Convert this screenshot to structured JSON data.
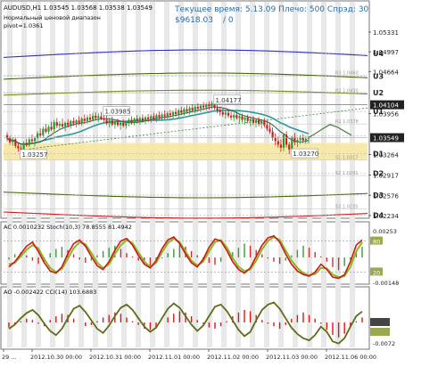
{
  "header": {
    "symbol_line": "AUDUSD,H1  1.03545 1.03568 1.03538 1.03549",
    "indicator_name": "Нормальный ценовой диапазон",
    "pivot_label": "pivot=1.0361",
    "status_line": "Текущее время: 5.13.09 Плечо: 500 Спрэд: 30",
    "balance": "$9618.03",
    "balance_suffix": "/ 0"
  },
  "colors": {
    "candle_up": "#2a9a2a",
    "candle_down": "#cc2020",
    "price_line": "#c04040",
    "ma_teal": "#2a9a98",
    "ma_dark": "#2c5a50",
    "band_green": "#7a8f1a",
    "band_dark_green": "#4a6a10",
    "band_blue": "#3030c0",
    "band_red": "#cc2020",
    "range_fill": "#f5e7a0",
    "stoch_main": "#d01818",
    "stoch_signal": "#8ab820",
    "cci_line": "#5a7018",
    "ao_bar": "#d81818"
  },
  "price_axis": {
    "labels": [
      {
        "text": "1.05331",
        "value": 1.05331
      },
      {
        "text": "1.04997",
        "value": 1.04997
      },
      {
        "text": "1.04664",
        "value": 1.04664
      },
      {
        "text": "1.04104",
        "value": 1.04104,
        "highlight": true
      },
      {
        "text": "1.03956",
        "value": 1.03956
      },
      {
        "text": "1.03549",
        "value": 1.03549,
        "highlight": true
      },
      {
        "text": "1.03264",
        "value": 1.03264
      },
      {
        "text": "1.02917",
        "value": 1.02917
      },
      {
        "text": "1.02576",
        "value": 1.02576
      },
      {
        "text": "1.02234",
        "value": 1.02234
      }
    ]
  },
  "pivot_levels": [
    {
      "label": "U4",
      "value": 1.0497
    },
    {
      "label": "U3",
      "value": 1.0459
    },
    {
      "label": "U2",
      "value": 1.0431
    },
    {
      "label": "U1",
      "value": 1.0399
    },
    {
      "label": "LB",
      "value": 1.0358
    },
    {
      "label": "D1",
      "value": 1.0328
    },
    {
      "label": "D2",
      "value": 1.0295
    },
    {
      "label": "D3",
      "value": 1.0258
    },
    {
      "label": "D4",
      "value": 1.0224
    }
  ],
  "faint_levels": [
    {
      "label": "R3 1.0460",
      "value": 1.046
    },
    {
      "label": "R2 1.0430",
      "value": 1.043
    },
    {
      "label": "R1 1.0378",
      "value": 1.0378
    },
    {
      "label": "S1 1.0317",
      "value": 1.0317
    },
    {
      "label": "S2 1.0291",
      "value": 1.0291
    },
    {
      "label": "S3 1.0235",
      "value": 1.0235
    }
  ],
  "price_annotations": [
    {
      "text": "1.03985",
      "value": 1.03985,
      "bar": 35
    },
    {
      "text": "1.04177",
      "value": 1.04177,
      "bar": 75
    },
    {
      "text": "1.03257",
      "value": 1.03257,
      "bar": 5
    },
    {
      "text": "1.03270",
      "value": 1.0327,
      "bar": 103
    }
  ],
  "ac_panel": {
    "label": "AC 0.0010232  Stoch(10,3) 78.8555 81.4942",
    "axis_labels": [
      "0.00253",
      "80",
      "20",
      "-0.00148"
    ]
  },
  "ao_panel": {
    "label": "AO -0.002422  CCI(14) 103.6883",
    "axis_labels": [
      "-0.0072"
    ]
  },
  "time_axis": {
    "labels": [
      "29 ...",
      "2012.10.30 00:00",
      "2012.10.31 00:00",
      "2012.11.01 00:00",
      "2012.11.02 00:00",
      "2012.11.03 00:00",
      "2012.11.06 00:00"
    ]
  },
  "chart_data": {
    "type": "candlestick",
    "symbol": "AUDUSD",
    "timeframe": "H1",
    "ohlc": [
      [
        1.0359,
        1.0364,
        1.0349,
        1.0354
      ],
      [
        1.0354,
        1.0358,
        1.0343,
        1.0347
      ],
      [
        1.0347,
        1.0356,
        1.0341,
        1.0352
      ],
      [
        1.0352,
        1.0355,
        1.0337,
        1.0341
      ],
      [
        1.0341,
        1.0346,
        1.0331,
        1.0337
      ],
      [
        1.0337,
        1.0342,
        1.0326,
        1.0333
      ],
      [
        1.0333,
        1.0349,
        1.033,
        1.0346
      ],
      [
        1.0346,
        1.0353,
        1.0339,
        1.0342
      ],
      [
        1.0342,
        1.0356,
        1.0339,
        1.0352
      ],
      [
        1.0352,
        1.036,
        1.0346,
        1.0349
      ],
      [
        1.0349,
        1.0357,
        1.034,
        1.0354
      ],
      [
        1.0354,
        1.0366,
        1.035,
        1.0362
      ],
      [
        1.0362,
        1.0371,
        1.0356,
        1.0359
      ],
      [
        1.0359,
        1.0374,
        1.0355,
        1.037
      ],
      [
        1.037,
        1.0378,
        1.0362,
        1.0365
      ],
      [
        1.0365,
        1.0376,
        1.036,
        1.0373
      ],
      [
        1.0373,
        1.0382,
        1.0366,
        1.0369
      ],
      [
        1.0369,
        1.0385,
        1.0365,
        1.0381
      ],
      [
        1.0381,
        1.0388,
        1.0371,
        1.0375
      ],
      [
        1.0375,
        1.0383,
        1.0368,
        1.0378
      ],
      [
        1.0378,
        1.0387,
        1.0371,
        1.0374
      ],
      [
        1.0374,
        1.0382,
        1.0366,
        1.038
      ],
      [
        1.038,
        1.0386,
        1.0372,
        1.0376
      ],
      [
        1.0376,
        1.0385,
        1.037,
        1.0383
      ],
      [
        1.0383,
        1.0389,
        1.0375,
        1.0379
      ],
      [
        1.0379,
        1.0386,
        1.0372,
        1.0384
      ],
      [
        1.0384,
        1.0391,
        1.0376,
        1.038
      ],
      [
        1.038,
        1.039,
        1.0375,
        1.0387
      ],
      [
        1.0387,
        1.0394,
        1.0378,
        1.0383
      ],
      [
        1.0383,
        1.0393,
        1.0378,
        1.0389
      ],
      [
        1.0389,
        1.0395,
        1.038,
        1.0385
      ],
      [
        1.0385,
        1.0397,
        1.0382,
        1.0392
      ],
      [
        1.0392,
        1.0398,
        1.0384,
        1.0388
      ],
      [
        1.0388,
        1.0396,
        1.0381,
        1.0391
      ],
      [
        1.0391,
        1.0398,
        1.0384,
        1.0387
      ],
      [
        1.0387,
        1.0396,
        1.038,
        1.0385
      ],
      [
        1.0385,
        1.0392,
        1.0376,
        1.0379
      ],
      [
        1.0379,
        1.0388,
        1.0372,
        1.0384
      ],
      [
        1.0384,
        1.039,
        1.0374,
        1.0377
      ],
      [
        1.0377,
        1.0386,
        1.037,
        1.0382
      ],
      [
        1.0382,
        1.0387,
        1.0373,
        1.0376
      ],
      [
        1.0376,
        1.0384,
        1.0368,
        1.038
      ],
      [
        1.038,
        1.0386,
        1.0372,
        1.0375
      ],
      [
        1.0375,
        1.0384,
        1.037,
        1.0381
      ],
      [
        1.0381,
        1.0388,
        1.0374,
        1.0385
      ],
      [
        1.0385,
        1.0391,
        1.0377,
        1.038
      ],
      [
        1.038,
        1.0389,
        1.0375,
        1.0387
      ],
      [
        1.0387,
        1.0393,
        1.0379,
        1.0383
      ],
      [
        1.0383,
        1.0391,
        1.0377,
        1.0388
      ],
      [
        1.0388,
        1.0394,
        1.038,
        1.0384
      ],
      [
        1.0384,
        1.0392,
        1.0378,
        1.0389
      ],
      [
        1.0389,
        1.0395,
        1.0381,
        1.0386
      ],
      [
        1.0386,
        1.0394,
        1.038,
        1.0391
      ],
      [
        1.0391,
        1.0397,
        1.0383,
        1.0387
      ],
      [
        1.0387,
        1.0396,
        1.0381,
        1.0393
      ],
      [
        1.0393,
        1.0399,
        1.0385,
        1.0389
      ],
      [
        1.0389,
        1.0397,
        1.0383,
        1.0394
      ],
      [
        1.0394,
        1.0401,
        1.0386,
        1.0391
      ],
      [
        1.0391,
        1.0399,
        1.0385,
        1.0396
      ],
      [
        1.0396,
        1.0402,
        1.0388,
        1.0393
      ],
      [
        1.0393,
        1.0401,
        1.0387,
        1.0398
      ],
      [
        1.0398,
        1.0405,
        1.039,
        1.0395
      ],
      [
        1.0395,
        1.0404,
        1.0389,
        1.0401
      ],
      [
        1.0401,
        1.0407,
        1.0393,
        1.0397
      ],
      [
        1.0397,
        1.0406,
        1.0392,
        1.0403
      ],
      [
        1.0403,
        1.0409,
        1.0395,
        1.0399
      ],
      [
        1.0399,
        1.0408,
        1.0394,
        1.0405
      ],
      [
        1.0405,
        1.0411,
        1.0397,
        1.0401
      ],
      [
        1.0401,
        1.041,
        1.0396,
        1.0407
      ],
      [
        1.0407,
        1.0413,
        1.0399,
        1.0404
      ],
      [
        1.0404,
        1.0412,
        1.0398,
        1.0409
      ],
      [
        1.0409,
        1.0415,
        1.0401,
        1.0406
      ],
      [
        1.0406,
        1.0414,
        1.04,
        1.0411
      ],
      [
        1.0411,
        1.0416,
        1.0402,
        1.0408
      ],
      [
        1.0408,
        1.0417,
        1.0403,
        1.0413
      ],
      [
        1.0413,
        1.0418,
        1.0402,
        1.0405
      ],
      [
        1.0405,
        1.0411,
        1.0396,
        1.0401
      ],
      [
        1.0401,
        1.0407,
        1.0392,
        1.0398
      ],
      [
        1.0398,
        1.0405,
        1.039,
        1.0394
      ],
      [
        1.0394,
        1.0402,
        1.0387,
        1.0397
      ],
      [
        1.0397,
        1.0403,
        1.0388,
        1.0392
      ],
      [
        1.0392,
        1.0399,
        1.0384,
        1.0389
      ],
      [
        1.0389,
        1.0397,
        1.0382,
        1.0393
      ],
      [
        1.0393,
        1.0399,
        1.0385,
        1.0388
      ],
      [
        1.0388,
        1.0395,
        1.038,
        1.0391
      ],
      [
        1.0391,
        1.0396,
        1.0381,
        1.0385
      ],
      [
        1.0385,
        1.0392,
        1.0377,
        1.0389
      ],
      [
        1.0389,
        1.0394,
        1.0379,
        1.0383
      ],
      [
        1.0383,
        1.039,
        1.0374,
        1.0386
      ],
      [
        1.0386,
        1.0391,
        1.0376,
        1.038
      ],
      [
        1.038,
        1.0388,
        1.0372,
        1.0385
      ],
      [
        1.0385,
        1.039,
        1.0374,
        1.0378
      ],
      [
        1.0378,
        1.0386,
        1.037,
        1.0383
      ],
      [
        1.0383,
        1.0388,
        1.0372,
        1.0376
      ],
      [
        1.0376,
        1.0384,
        1.0366,
        1.037
      ],
      [
        1.037,
        1.0379,
        1.0361,
        1.0365
      ],
      [
        1.0365,
        1.0372,
        1.035,
        1.0355
      ],
      [
        1.0355,
        1.0362,
        1.0342,
        1.0349
      ],
      [
        1.0349,
        1.0357,
        1.0338,
        1.0343
      ],
      [
        1.0343,
        1.0352,
        1.0331,
        1.0338
      ],
      [
        1.0338,
        1.0362,
        1.0332,
        1.036
      ],
      [
        1.036,
        1.0366,
        1.0338,
        1.0343
      ],
      [
        1.0343,
        1.0348,
        1.0327,
        1.0335
      ],
      [
        1.0335,
        1.0358,
        1.0333,
        1.0356
      ],
      [
        1.0356,
        1.0363,
        1.0342,
        1.0347
      ],
      [
        1.0347,
        1.0355,
        1.0339,
        1.0351
      ],
      [
        1.0351,
        1.0359,
        1.0344,
        1.0355
      ],
      [
        1.0355,
        1.0361,
        1.0346,
        1.035
      ],
      [
        1.035,
        1.0358,
        1.0344,
        1.0353
      ],
      [
        1.0353,
        1.0357,
        1.0345,
        1.0355
      ]
    ],
    "ylim": [
      1.02234,
      1.05331
    ],
    "forecast": [
      1.0355,
      1.0362,
      1.037,
      1.0377,
      1.0373,
      1.0366,
      1.0359
    ],
    "ac_hist": [
      -0.2,
      0.3,
      0.5,
      0.2,
      -0.3,
      -0.6,
      -0.4,
      0.4,
      0.8,
      1.0,
      0.7,
      0.3,
      -0.2,
      -0.5,
      -0.3,
      0.2,
      0.6,
      0.9,
      1.1,
      0.8,
      0.4,
      0.1,
      -0.3,
      -0.6,
      -0.8,
      -0.5,
      -0.1,
      0.4,
      0.8,
      1.2,
      1.0,
      0.6,
      0.2,
      -0.2,
      -0.5,
      -0.7,
      -0.4,
      0.0,
      0.5,
      0.9,
      1.3,
      1.1,
      0.7,
      0.3,
      -0.1,
      -0.4,
      -0.6,
      -0.3,
      0.2,
      0.7,
      1.1,
      0.9,
      0.5,
      0.1,
      -0.4,
      -0.9,
      -1.2,
      -0.8,
      -0.2,
      0.6,
      1.0
    ],
    "stoch_main": [
      30,
      40,
      55,
      70,
      78,
      60,
      38,
      22,
      18,
      30,
      55,
      75,
      82,
      70,
      50,
      32,
      25,
      40,
      62,
      80,
      85,
      72,
      52,
      35,
      28,
      42,
      65,
      82,
      88,
      75,
      55,
      38,
      30,
      45,
      68,
      84,
      80,
      62,
      40,
      25,
      18,
      28,
      50,
      72,
      86,
      90,
      78,
      55,
      35,
      22,
      15,
      12,
      20,
      35,
      25,
      10,
      8,
      15,
      40,
      72,
      82
    ],
    "stoch_signal": [
      35,
      38,
      50,
      63,
      72,
      66,
      45,
      28,
      20,
      26,
      46,
      66,
      78,
      74,
      57,
      38,
      28,
      35,
      55,
      72,
      82,
      76,
      58,
      40,
      30,
      38,
      58,
      76,
      85,
      78,
      60,
      42,
      33,
      40,
      60,
      78,
      82,
      68,
      47,
      30,
      22,
      25,
      42,
      64,
      80,
      88,
      82,
      62,
      42,
      28,
      18,
      14,
      16,
      28,
      27,
      15,
      10,
      12,
      30,
      60,
      78
    ],
    "ao_hist": [
      -0.4,
      -0.2,
      0.1,
      0.3,
      0.2,
      -0.1,
      -0.3,
      0.2,
      0.5,
      0.7,
      0.6,
      0.3,
      0.0,
      -0.3,
      -0.2,
      0.1,
      0.4,
      0.6,
      0.8,
      0.7,
      0.4,
      0.1,
      -0.2,
      -0.5,
      -0.6,
      -0.4,
      0.0,
      0.4,
      0.7,
      0.9,
      0.8,
      0.5,
      0.2,
      -0.1,
      -0.4,
      -0.5,
      -0.3,
      0.1,
      0.5,
      0.8,
      1.0,
      0.9,
      0.6,
      0.2,
      -0.1,
      -0.3,
      -0.5,
      -0.2,
      0.3,
      0.6,
      0.8,
      0.6,
      0.3,
      -0.1,
      -0.6,
      -1.0,
      -1.2,
      -0.9,
      -0.4,
      0.1,
      0.4
    ],
    "cci": [
      -60,
      -20,
      40,
      90,
      120,
      70,
      -10,
      -80,
      -120,
      -60,
      40,
      130,
      160,
      100,
      20,
      -60,
      -100,
      -30,
      60,
      140,
      170,
      120,
      40,
      -40,
      -90,
      -50,
      40,
      130,
      180,
      140,
      60,
      -20,
      -80,
      -30,
      60,
      150,
      170,
      110,
      20,
      -70,
      -130,
      -90,
      20,
      120,
      170,
      190,
      130,
      40,
      -50,
      -110,
      -150,
      -170,
      -120,
      -40,
      -90,
      -180,
      -200,
      -150,
      -40,
      60,
      104
    ]
  }
}
